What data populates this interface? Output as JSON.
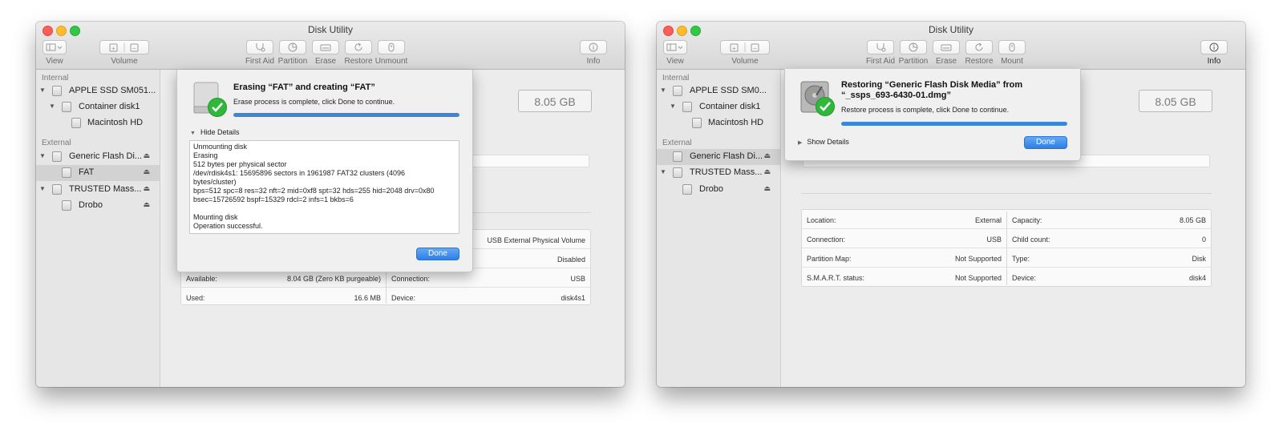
{
  "windows": [
    {
      "title": "Disk Utility",
      "toolbar": {
        "view_label": "View",
        "volume_label": "Volume",
        "first_aid_label": "First Aid",
        "partition_label": "Partition",
        "erase_label": "Erase",
        "restore_label": "Restore",
        "mount_label": "Unmount",
        "info_label": "Info"
      },
      "sidebar": {
        "internal_label": "Internal",
        "external_label": "External",
        "items": [
          "APPLE SSD SM051...",
          "Container disk1",
          "Macintosh HD",
          "Generic Flash Di...",
          "FAT",
          "TRUSTED Mass...",
          "Drobo"
        ],
        "selected_index": 4
      },
      "main": {
        "capacity": "8.05 GB",
        "rows": [
          {
            "k": "",
            "v": "USB External Physical Volume"
          },
          {
            "k": "",
            "v": "Disabled"
          },
          {
            "k": "Available:",
            "v": "8.04 GB (Zero KB purgeable)",
            "k2": "Connection:",
            "v2": "USB"
          },
          {
            "k": "Used:",
            "v": "16.6 MB",
            "k2": "Device:",
            "v2": "disk4s1"
          }
        ]
      },
      "sheet": {
        "title": "Erasing “FAT” and creating “FAT”",
        "subtitle": "Erase process is complete, click Done to continue.",
        "progress": 1.0,
        "details_toggle": "Hide Details",
        "log": [
          "Unmounting disk",
          "Erasing",
          "512 bytes per physical sector",
          "/dev/rdisk4s1: 15695896 sectors in 1961987 FAT32 clusters (4096",
          "bytes/cluster)",
          "bps=512 spc=8 res=32 nft=2 mid=0xf8 spt=32 hds=255 hid=2048 drv=0x80",
          "bsec=15726592 bspf=15329 rdcl=2 infs=1 bkbs=6",
          "",
          "Mounting disk",
          "Operation successful."
        ],
        "done_label": "Done"
      }
    },
    {
      "title": "Disk Utility",
      "toolbar": {
        "view_label": "View",
        "volume_label": "Volume",
        "first_aid_label": "First Aid",
        "partition_label": "Partition",
        "erase_label": "Erase",
        "restore_label": "Restore",
        "mount_label": "Mount",
        "info_label": "Info"
      },
      "sidebar": {
        "internal_label": "Internal",
        "external_label": "External",
        "items": [
          "APPLE SSD SM0...",
          "Container disk1",
          "Macintosh HD",
          "Generic Flash Di...",
          "TRUSTED Mass...",
          "Drobo"
        ],
        "selected_index": 3
      },
      "main": {
        "capacity": "8.05 GB",
        "rows": [
          {
            "k": "Location:",
            "v": "External",
            "k2": "Capacity:",
            "v2": "8.05 GB"
          },
          {
            "k": "Connection:",
            "v": "USB",
            "k2": "Child count:",
            "v2": "0"
          },
          {
            "k": "Partition Map:",
            "v": "Not Supported",
            "k2": "Type:",
            "v2": "Disk"
          },
          {
            "k": "S.M.A.R.T. status:",
            "v": "Not Supported",
            "k2": "Device:",
            "v2": "disk4"
          }
        ]
      },
      "sheet": {
        "title_line1": "Restoring “Generic Flash Disk Media” from",
        "title_line2": "“_ssps_693-6430-01.dmg”",
        "subtitle": "Restore process is complete, click Done to continue.",
        "progress": 1.0,
        "details_toggle": "Show Details",
        "done_label": "Done"
      }
    }
  ],
  "colors": {
    "accent": "#3b86d6",
    "close": "#fc5f57",
    "minimize": "#fdbc2e",
    "maximize": "#33c748",
    "success": "#2fb83a"
  }
}
